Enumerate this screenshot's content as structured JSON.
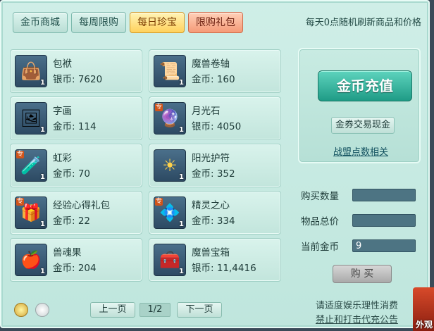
{
  "tabs": [
    {
      "label": "金币商城"
    },
    {
      "label": "每周限购"
    },
    {
      "label": "每日珍宝"
    },
    {
      "label": "限购礼包"
    }
  ],
  "notice": "每天0点随机刷新商品和价格",
  "items": [
    {
      "name": "包袱",
      "price": "银币: 7620",
      "qty": "1",
      "icon": "bag-icon",
      "tag": ""
    },
    {
      "name": "魔兽卷轴",
      "price": "金币: 160",
      "qty": "1",
      "icon": "scroll-icon",
      "tag": ""
    },
    {
      "name": "字画",
      "price": "金币: 114",
      "qty": "1",
      "icon": "painting-icon",
      "tag": ""
    },
    {
      "name": "月光石",
      "price": "银币: 4050",
      "qty": "1",
      "icon": "moonstone-icon",
      "tag": "专"
    },
    {
      "name": "虹彩",
      "price": "金币: 70",
      "qty": "1",
      "icon": "potion-icon",
      "tag": "专"
    },
    {
      "name": "阳光护符",
      "price": "金币: 352",
      "qty": "1",
      "icon": "amulet-icon",
      "tag": ""
    },
    {
      "name": "经验心得礼包",
      "price": "金币: 22",
      "qty": "1",
      "icon": "gift-bag-icon",
      "tag": "专"
    },
    {
      "name": "精灵之心",
      "price": "金币: 334",
      "qty": "1",
      "icon": "spirit-heart-icon",
      "tag": "专"
    },
    {
      "name": "兽魂果",
      "price": "金币: 204",
      "qty": "1",
      "icon": "fruit-icon",
      "tag": ""
    },
    {
      "name": "魔兽宝箱",
      "price": "银币: 11,4416",
      "qty": "1",
      "icon": "treasure-chest-icon",
      "tag": ""
    }
  ],
  "right": {
    "recharge": "金币充值",
    "exchange": "金券交易现金",
    "alliance_link": "战盟点数相关"
  },
  "purchase": {
    "qty_label": "购买数量",
    "total_label": "物品总价",
    "gold_label": "当前金币",
    "qty_value": "",
    "total_value": "",
    "gold_value": "9",
    "buy": "购 买"
  },
  "pager": {
    "prev": "上一页",
    "indicator": "1/2",
    "next": "下一页"
  },
  "footer": {
    "line1": "请适度娱乐理性消费",
    "line2": "禁止和打击代充公告"
  },
  "corner_label": "外观"
}
